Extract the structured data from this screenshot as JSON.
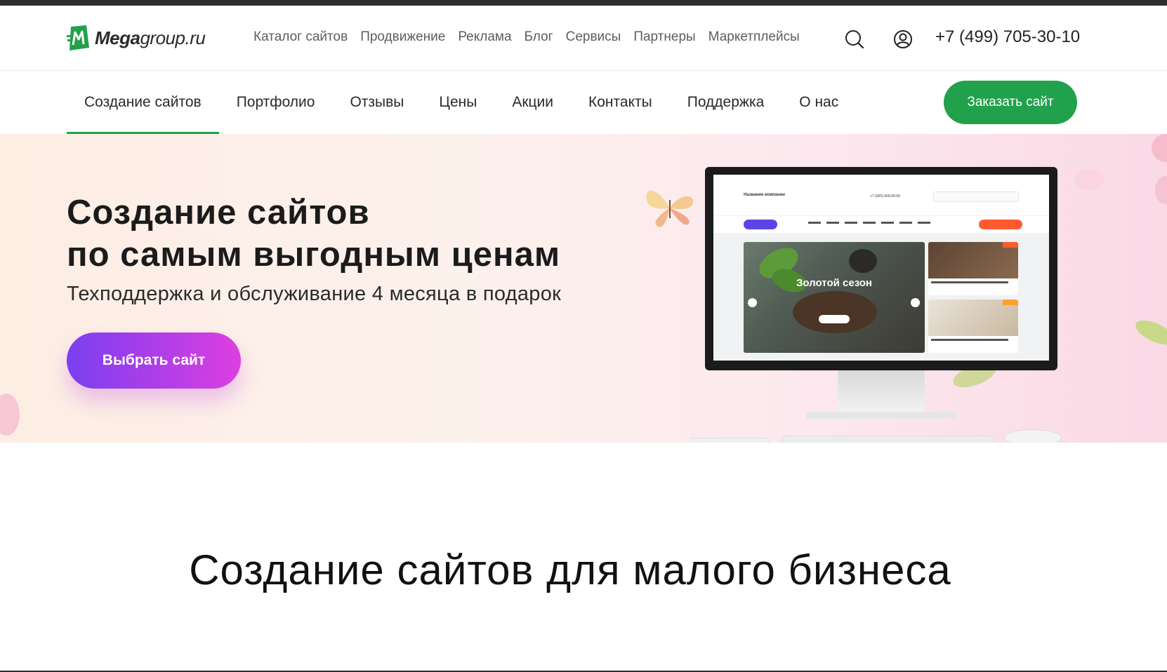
{
  "header": {
    "logo": {
      "brand": "Mega",
      "suffix": "group.ru"
    },
    "top_nav": [
      "Каталог сайтов",
      "Продвижение",
      "Реклама",
      "Блог",
      "Сервисы",
      "Партнеры",
      "Маркетплейсы"
    ],
    "phone": "+7 (499) 705-30-10",
    "icons": [
      "search-icon",
      "user-account-icon"
    ]
  },
  "main_nav": {
    "items": [
      "Создание сайтов",
      "Портфолио",
      "Отзывы",
      "Цены",
      "Акции",
      "Контакты",
      "Поддержка",
      "О нас"
    ],
    "active": "Создание сайтов",
    "cta": "Заказать сайт"
  },
  "hero": {
    "title_line1": "Создание сайтов",
    "title_line2": "по самым выгодным ценам",
    "subtitle": "Техподдержка и обслуживание 4 месяца в подарок",
    "button": "Выбрать сайт",
    "screen_mockup": {
      "company": "Название компании",
      "phone": "+7 (000) 000-00-00",
      "slide_title": "Золотой сезон"
    }
  },
  "section": {
    "title": "Создание сайтов для малого бизнеса"
  },
  "colors": {
    "brand_green": "#21a14b",
    "cta_gradient_start": "#7b3ff0",
    "cta_gradient_end": "#dd3fe0",
    "top_bar": "#2d2d2d"
  }
}
